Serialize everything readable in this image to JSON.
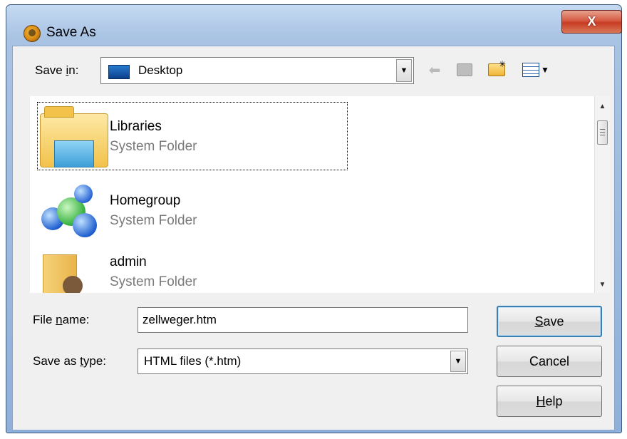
{
  "window": {
    "title": "Save As",
    "close_glyph": "X"
  },
  "save_in": {
    "label_pre": "Save ",
    "label_mnemonic": "i",
    "label_post": "n:",
    "value": "Desktop"
  },
  "toolbar": {
    "back_icon": "back-arrow-icon",
    "up_icon": "up-folder-icon",
    "new_folder_icon": "new-folder-icon",
    "view_menu_icon": "view-menu-icon"
  },
  "items": [
    {
      "name": "Libraries",
      "type": "System Folder"
    },
    {
      "name": "Homegroup",
      "type": "System Folder"
    },
    {
      "name": "admin",
      "type": "System Folder"
    }
  ],
  "file_name": {
    "label_pre": "File ",
    "label_mnemonic": "n",
    "label_post": "ame:",
    "value": "zellweger.htm"
  },
  "save_type": {
    "label_pre": "Save as ",
    "label_mnemonic": "t",
    "label_post": "ype:",
    "value": "HTML files (*.htm)"
  },
  "buttons": {
    "save_mnemonic": "S",
    "save_rest": "ave",
    "cancel": "Cancel",
    "help_mnemonic": "H",
    "help_rest": "elp"
  },
  "colors": {
    "selection_border": "#000000",
    "subtext": "#7a7a7a",
    "close_red": "#c73b22"
  }
}
